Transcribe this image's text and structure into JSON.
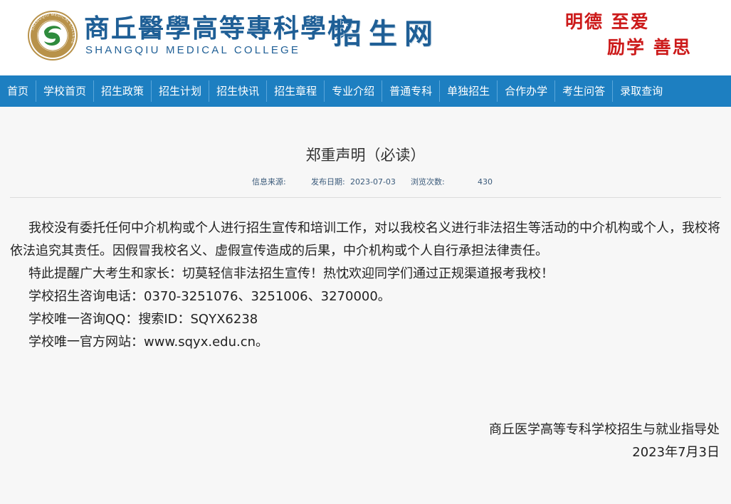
{
  "header": {
    "brand_cn": "商丘醫學高等專科學校",
    "brand_en": "SHANGQIU MEDICAL COLLEGE",
    "brand_sub": "招生网",
    "seal_text": "SHANGQIU MEDICAL COLLEGE",
    "motto_line1": "明德 至爱",
    "motto_line2": "励学 善思"
  },
  "nav": {
    "items": [
      {
        "label": "首页"
      },
      {
        "label": "学校首页"
      },
      {
        "label": "招生政策"
      },
      {
        "label": "招生计划"
      },
      {
        "label": "招生快讯"
      },
      {
        "label": "招生章程"
      },
      {
        "label": "专业介绍"
      },
      {
        "label": "普通专科"
      },
      {
        "label": "单独招生"
      },
      {
        "label": "合作办学"
      },
      {
        "label": "考生问答"
      },
      {
        "label": "录取查询"
      }
    ]
  },
  "article": {
    "title": "郑重声明（必读）",
    "meta": {
      "source_label": "信息来源:",
      "date_label": "发布日期:",
      "date_value": "2023-07-03",
      "views_label": "浏览次数:",
      "views_value": "430"
    },
    "paragraphs": [
      "我校没有委托任何中介机构或个人进行招生宣传和培训工作，对以我校名义进行非法招生等活动的中介机构或个人，我校将依法追究其责任。因假冒我校名义、虚假宣传造成的后果，中介机构或个人自行承担法律责任。",
      "特此提醒广大考生和家长：切莫轻信非法招生宣传！热忱欢迎同学们通过正规渠道报考我校！",
      "学校招生咨询电话：0370-3251076、3251006、3270000。",
      "学校唯一咨询QQ：搜索ID：SQYX6238",
      "学校唯一官方网站：www.sqyx.edu.cn。"
    ],
    "signature_org": "商丘医学高等专科学校招生与就业指导处",
    "signature_date": "2023年7月3日"
  },
  "colors": {
    "nav_bg": "#1d7fc1",
    "brand_blue": "#1f5f96",
    "motto_red": "#cc1a1a",
    "seal_green": "#2e8b3d",
    "seal_gold": "#b8924a"
  }
}
